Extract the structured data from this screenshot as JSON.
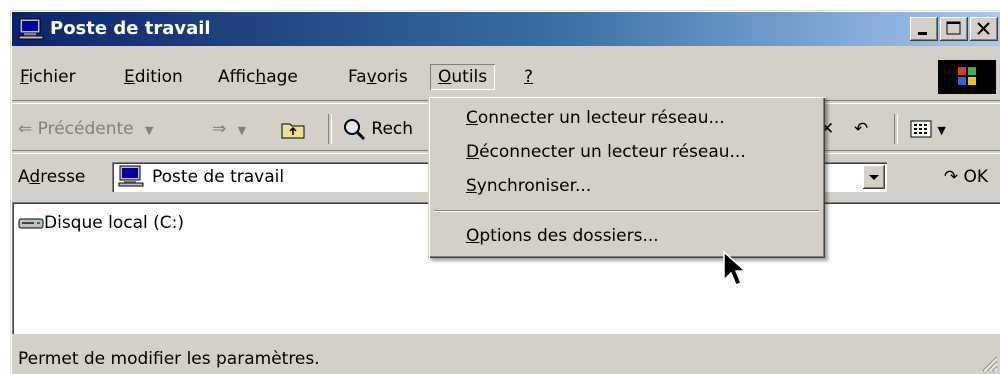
{
  "window": {
    "title": "Poste de travail"
  },
  "menubar": {
    "items": [
      {
        "label": "Fichier",
        "accesskey": "F"
      },
      {
        "label": "Edition",
        "accesskey": "E"
      },
      {
        "label": "Affichage",
        "accesskey": "h"
      },
      {
        "label": "Favoris",
        "accesskey": "v"
      },
      {
        "label": "Outils",
        "accesskey": "O",
        "active": true
      },
      {
        "label": "?",
        "accesskey": "?"
      }
    ]
  },
  "toolbar": {
    "back_label": "Précédente",
    "search_label": "Rech"
  },
  "addressbar": {
    "label": "Adresse",
    "value": "Poste de travail",
    "go_label": "OK"
  },
  "content": {
    "items": [
      {
        "label": "Disque local (C:)",
        "icon": "hard-drive-icon"
      }
    ]
  },
  "dropdown": {
    "items": [
      {
        "label": "Connecter un lecteur réseau...",
        "accesskey": "C"
      },
      {
        "label": "Déconnecter un lecteur réseau...",
        "accesskey": "D"
      },
      {
        "label": "Synchroniser...",
        "accesskey": "S"
      },
      {
        "label": "Options des dossiers...",
        "accesskey": "O"
      }
    ]
  },
  "statusbar": {
    "text": "Permet de modifier les paramètres."
  },
  "colors": {
    "titlebar_start": "#0a246a",
    "titlebar_end": "#a6caf0",
    "face": "#d4d0c8"
  }
}
